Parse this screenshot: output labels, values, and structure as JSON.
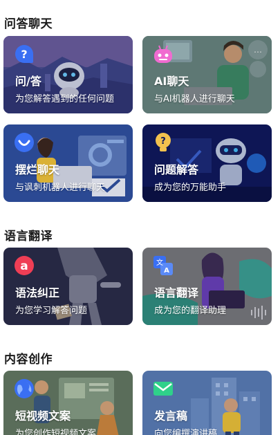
{
  "sections": [
    {
      "title": "问答聊天",
      "cards": [
        {
          "title": "问/答",
          "subtitle": "为您解答遇到的任何问题",
          "icon": "question-bubble-icon"
        },
        {
          "title": "AI聊天",
          "subtitle": "与AI机器人进行聊天",
          "icon": "robot-icon"
        },
        {
          "title": "摆烂聊天",
          "subtitle": "与讽刺机器人进行聊天",
          "icon": "smile-bubble-icon"
        },
        {
          "title": "问题解答",
          "subtitle": "成为您的万能助手",
          "icon": "lightbulb-question-icon"
        }
      ]
    },
    {
      "title": "语言翻译",
      "cards": [
        {
          "title": "语法纠正",
          "subtitle": "为您学习解答问题",
          "icon": "grammar-a-icon"
        },
        {
          "title": "语言翻译",
          "subtitle": "成为您的翻译助理",
          "icon": "translate-icon"
        }
      ]
    },
    {
      "title": "内容创作",
      "cards": [
        {
          "title": "短视频文案",
          "subtitle": "为您创作短视频文案",
          "icon": "globe-icon"
        },
        {
          "title": "发言稿",
          "subtitle": "向您编撰演讲稿",
          "icon": "mail-icon"
        }
      ]
    }
  ],
  "colors": {
    "icon_blue": "#3a6ff2",
    "icon_pink": "#f06bd0",
    "icon_yellow": "#f2c14e",
    "icon_red": "#ef3e55",
    "icon_green": "#2fd18a"
  }
}
